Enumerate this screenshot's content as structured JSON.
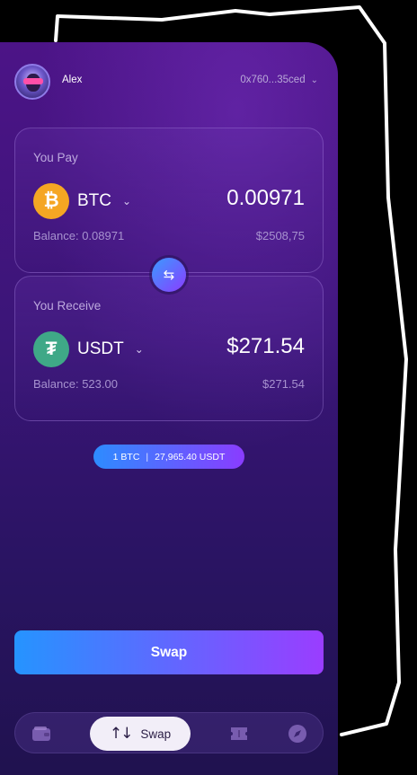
{
  "header": {
    "username": "Alex",
    "wallet_address": "0x760...35ced",
    "avatar_icon": "avatar-icon",
    "dropdown_icon": "chevron-down-icon"
  },
  "pay": {
    "label": "You Pay",
    "token": "BTC",
    "token_icon": "bitcoin-icon",
    "token_symbol": "₿",
    "amount": "0.00971",
    "balance": "Balance: 0.08971",
    "fiat": "$2508,75"
  },
  "receive": {
    "label": "You Receive",
    "token": "USDT",
    "token_icon": "tether-icon",
    "token_symbol": "₮",
    "amount": "$271.54",
    "balance": "Balance: 523.00",
    "fiat": "$271.54"
  },
  "swap_toggle_icon": "swap-arrows-icon",
  "rate": {
    "base": "1 BTC",
    "quote": "27,965.40 USDT"
  },
  "actions": {
    "swap_label": "Swap"
  },
  "bottom_nav": {
    "items": [
      {
        "icon": "wallet-icon",
        "active": false
      },
      {
        "icon": "swap-arrows-icon",
        "label": "Swap",
        "active": true
      },
      {
        "icon": "ticket-icon",
        "active": false
      },
      {
        "icon": "explore-icon",
        "active": false
      }
    ]
  },
  "colors": {
    "accent_blue": "#2594ff",
    "accent_purple": "#9a3dff",
    "btc": "#f5a623",
    "usdt": "#3fa887",
    "background": "#3b1578"
  }
}
